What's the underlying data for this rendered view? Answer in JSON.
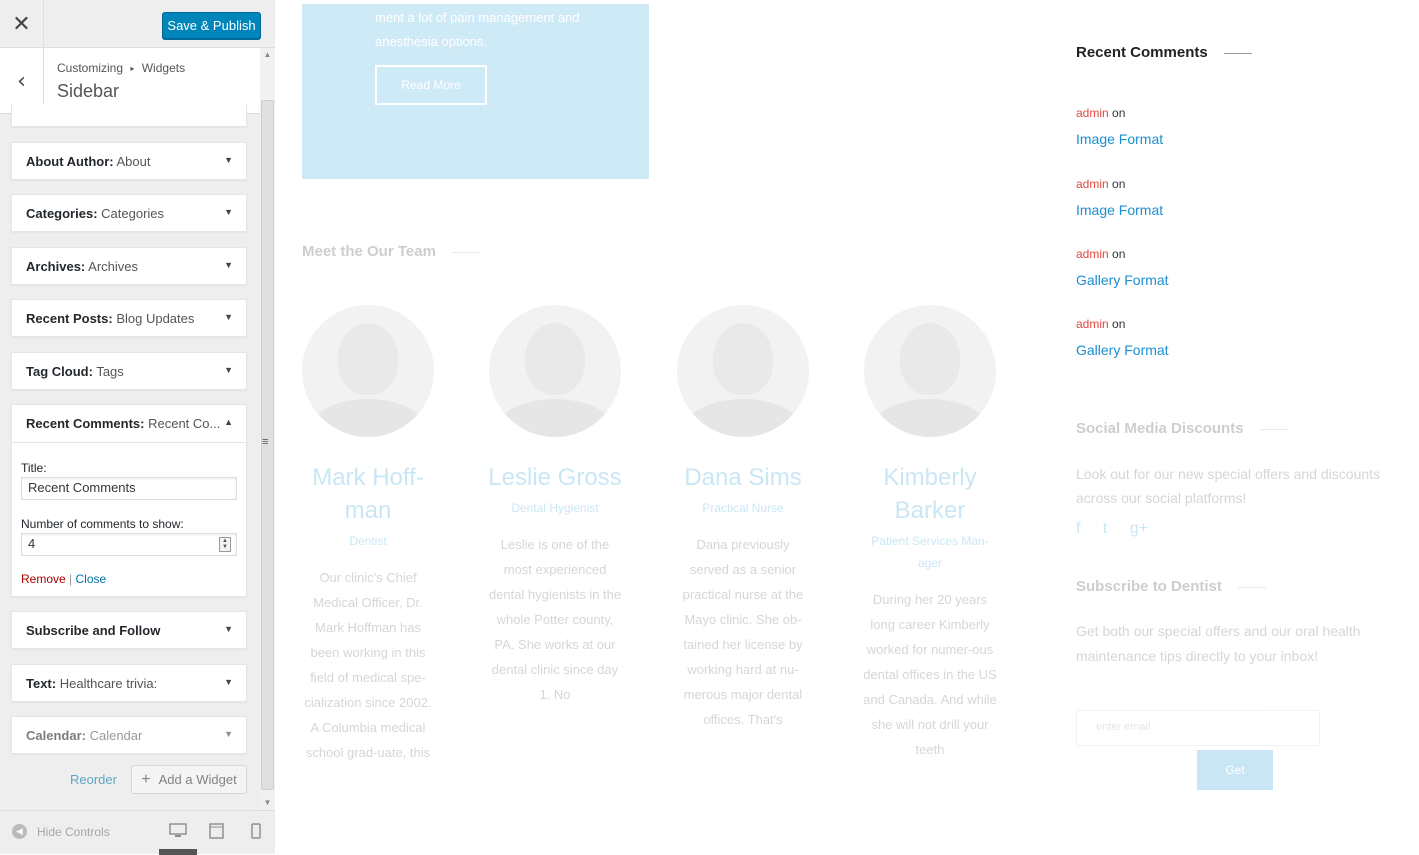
{
  "customizer": {
    "close_icon": "close-icon",
    "save_label": "Save & Publish",
    "breadcrumb_parent": "Customizing",
    "breadcrumb_separator": "▸",
    "breadcrumb_current": "Widgets",
    "section_title": "Sidebar",
    "widgets": [
      {
        "type": "About Author:",
        "title": "About"
      },
      {
        "type": "Categories:",
        "title": "Categories"
      },
      {
        "type": "Archives:",
        "title": "Archives"
      },
      {
        "type": "Recent Posts:",
        "title": "Blog Updates"
      },
      {
        "type": "Tag Cloud:",
        "title": "Tags"
      },
      {
        "type": "Recent Comments:",
        "title": "Recent Co..."
      },
      {
        "type": "Subscribe and Follow",
        "title": ""
      },
      {
        "type": "Text:",
        "title": "Healthcare trivia:"
      },
      {
        "type": "Calendar:",
        "title": "Calendar"
      }
    ],
    "open_widget": {
      "title_label": "Title:",
      "title_value": "Recent Comments",
      "count_label": "Number of comments to show:",
      "count_value": "4",
      "remove_label": "Remove",
      "divider": "|",
      "close_label": "Close"
    },
    "reorder_label": "Reorder",
    "add_widget_label": "Add a Widget",
    "hide_controls_label": "Hide Controls"
  },
  "preview": {
    "hero_text": "ment a lot of pain management and anesthesia options.",
    "hero_button": "Read More",
    "team_heading": "Meet the Our Team",
    "team": [
      {
        "name": "Mark Hoff-man",
        "role": "Dentist",
        "bio": "Our clinic's Chief Medical Officer, Dr. Mark Hoffman has been working in this field of medical spe-cialization since 2002. A Columbia medical school grad-uate, this"
      },
      {
        "name": "Leslie Gross",
        "role": "Dental Hygienist",
        "bio": "Leslie is one of the most experienced dental hygienists in the whole Potter county, PA. She works at our dental clinic since day 1. No"
      },
      {
        "name": "Dana Sims",
        "role": "Practical Nurse",
        "bio": "Dana previously served as a senior practical nurse at the Mayo clinic. She ob-tained her license by working hard at nu-merous major dental offices. That's"
      },
      {
        "name": "Kimberly Barker",
        "role": "Patient Services Man-ager",
        "bio": "During her 20 years long career Kimberly worked for numer-ous dental offices in the US and Canada. And while she will not drill your teeth"
      }
    ],
    "recent_comments_title": "Recent Comments",
    "comments": [
      {
        "author": "admin",
        "on": "on",
        "post": "Image Format"
      },
      {
        "author": "admin",
        "on": "on",
        "post": "Image Format"
      },
      {
        "author": "admin",
        "on": "on",
        "post": "Gallery Format"
      },
      {
        "author": "admin",
        "on": "on",
        "post": "Gallery Format"
      }
    ],
    "social_title": "Social Media Discounts",
    "social_text": "Look out for our new special offers and discounts across our social platforms!",
    "social_icons": [
      "f",
      "t",
      "g+"
    ],
    "subscribe_title": "Subscribe to Dentist",
    "subscribe_text": "Get both our special offers and our oral health maintenance tips directly to your inbox!",
    "email_placeholder": "enter email",
    "get_button": "Get"
  },
  "colors": {
    "primary_button": "#0085ba",
    "link": "#0073aa",
    "remove": "#a00",
    "accent": "#0d8fcf",
    "author": "#e2473f",
    "hero_bg": "#cfeaf7"
  }
}
